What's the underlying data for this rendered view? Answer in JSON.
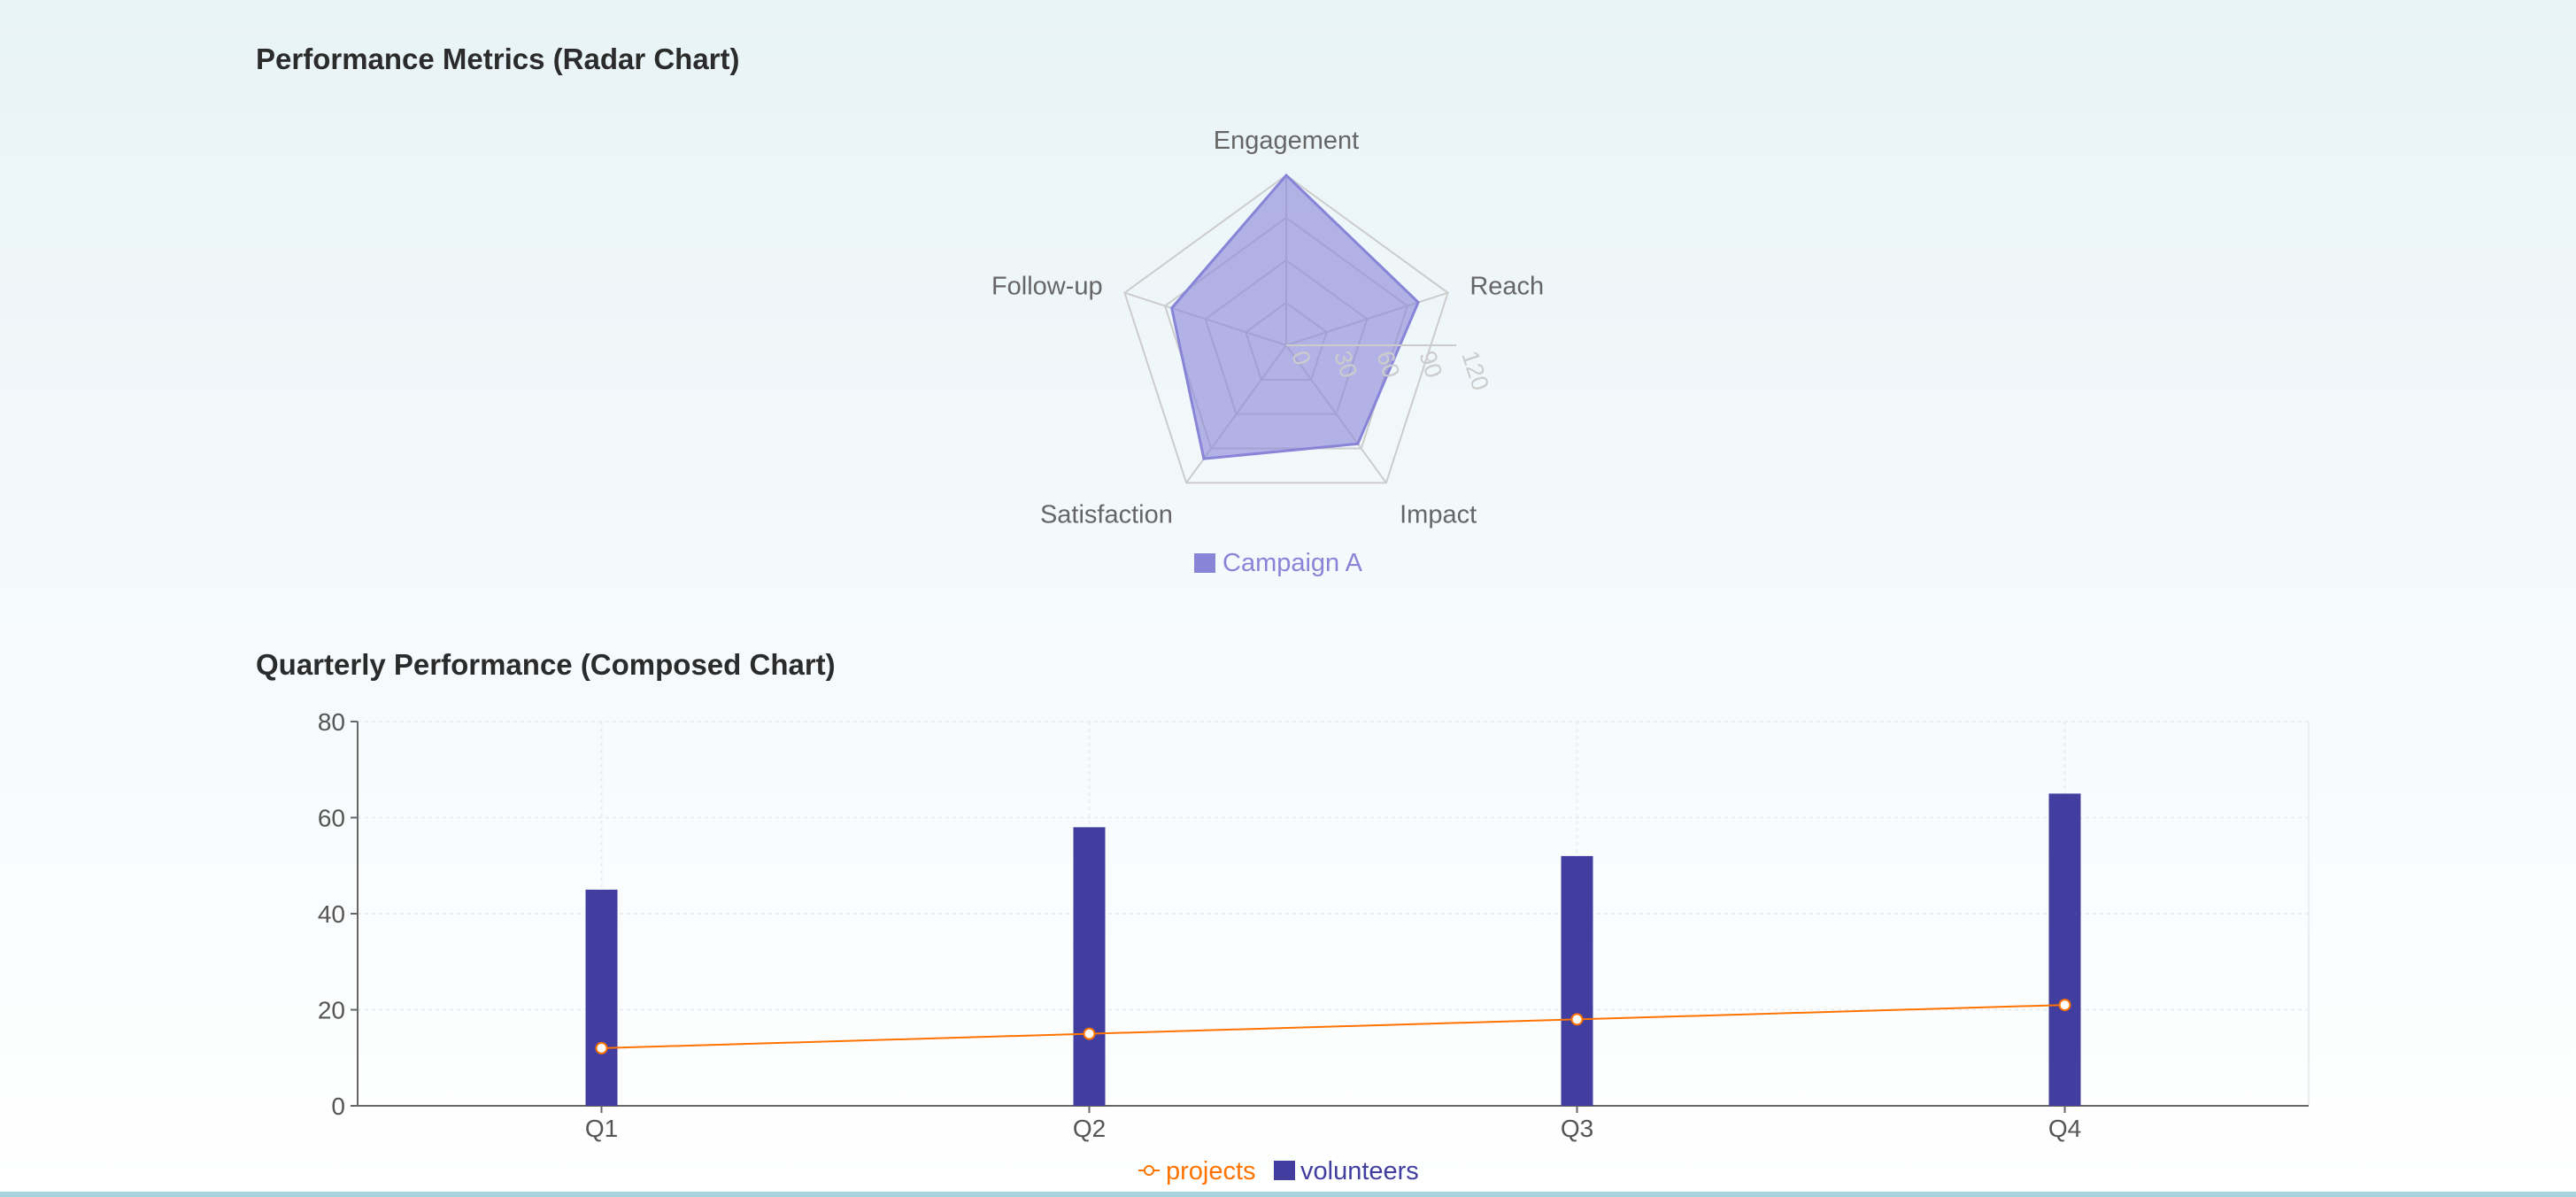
{
  "sections": {
    "radar_title": "Performance Metrics (Radar Chart)",
    "composed_title": "Quarterly Performance (Composed Chart)"
  },
  "colors": {
    "radar_fill": "#8884d8",
    "bar": "#413ea0",
    "line": "#ff7300",
    "grid": "#cccccc",
    "axis_text": "#666666"
  },
  "chart_data": [
    {
      "type": "radar",
      "axes": [
        "Engagement",
        "Reach",
        "Impact",
        "Satisfaction",
        "Follow-up"
      ],
      "radial_ticks": [
        0,
        30,
        60,
        90,
        120
      ],
      "radial_domain": [
        0,
        120
      ],
      "series": [
        {
          "name": "Campaign A",
          "values": [
            120,
            98,
            86,
            99,
            85
          ]
        }
      ],
      "legend_position": "bottom"
    },
    {
      "type": "bar",
      "composed": true,
      "categories": [
        "Q1",
        "Q2",
        "Q3",
        "Q4"
      ],
      "series": [
        {
          "name": "projects",
          "kind": "line",
          "values": [
            12,
            15,
            18,
            21
          ]
        },
        {
          "name": "volunteers",
          "kind": "bar",
          "values": [
            45,
            58,
            52,
            65
          ]
        }
      ],
      "ylim": [
        0,
        80
      ],
      "yticks": [
        0,
        20,
        40,
        60,
        80
      ],
      "grid": true,
      "legend_position": "bottom"
    }
  ]
}
